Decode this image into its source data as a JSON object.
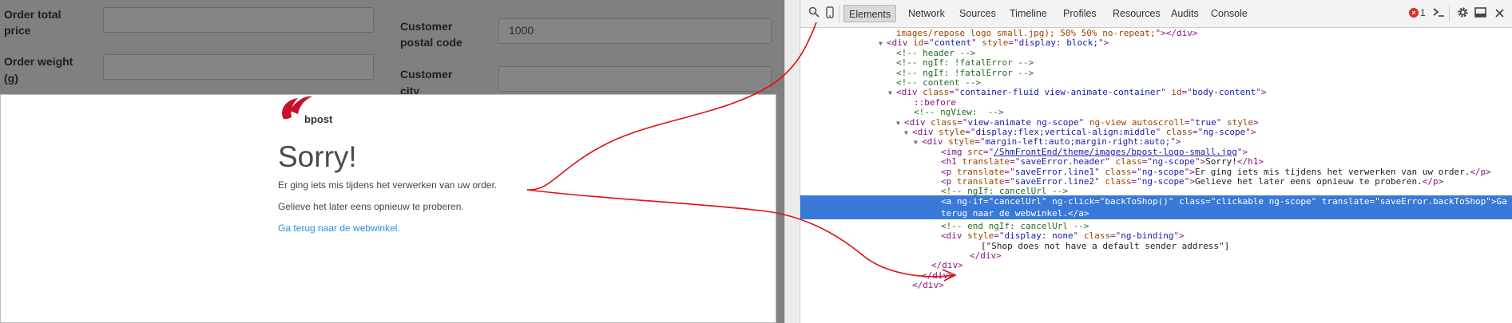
{
  "form": {
    "order_total_label_1": "Order total",
    "order_total_label_2": "price",
    "order_total_value": "",
    "order_weight_label_1": "Order weight",
    "order_weight_label_2": "(g)",
    "order_weight_value": "",
    "customer_postal_label_1": "Customer",
    "customer_postal_label_2": "postal code",
    "customer_postal_value": "1000",
    "customer_city_label_1": "Customer",
    "customer_city_label_2": "city",
    "customer_city_value": ""
  },
  "modal": {
    "logo_text": "bpost",
    "logo_color": "#c8102e",
    "heading": "Sorry!",
    "line1": "Er ging iets mis tijdens het verwerken van uw order.",
    "line2": "Gelieve het later eens opnieuw te proberen.",
    "back_link": "Ga terug naar de webwinkel."
  },
  "devtools": {
    "icons": [
      "search-icon",
      "device-icon"
    ],
    "tabs": [
      {
        "label": "Elements",
        "active": true
      },
      {
        "label": "Network",
        "active": false
      },
      {
        "label": "Sources",
        "active": false
      },
      {
        "label": "Timeline",
        "active": false
      },
      {
        "label": "Profiles",
        "active": false
      },
      {
        "label": "Resources",
        "active": false
      },
      {
        "label": "Audits",
        "active": false
      },
      {
        "label": "Console",
        "active": false
      }
    ],
    "error_count": "1",
    "right_icons": [
      "console-drawer-icon",
      "gear-icon",
      "dock-icon",
      "close-icon"
    ],
    "selection_color": "#3879d9",
    "dom_lines": [
      {
        "indent": 120,
        "parts": [
          [
            "t-attr",
            "images/repose logo small.jpg); 50% 50% no-repeat;"
          ],
          [
            "t-tag",
            "\"></div>"
          ]
        ]
      },
      {
        "indent": 108,
        "tw": "▼",
        "parts": [
          [
            "t-tag",
            "<div "
          ],
          [
            "t-attr",
            "id"
          ],
          [
            "t-tag",
            "=\""
          ],
          [
            "t-val",
            "content"
          ],
          [
            "t-tag",
            "\" "
          ],
          [
            "t-attr",
            "style"
          ],
          [
            "t-tag",
            "=\""
          ],
          [
            "t-val",
            "display: block;"
          ],
          [
            "t-tag",
            "\">"
          ]
        ]
      },
      {
        "indent": 120,
        "parts": [
          [
            "t-comment",
            "<!-- header -->"
          ]
        ]
      },
      {
        "indent": 120,
        "parts": [
          [
            "t-comment",
            "<!-- ngIf: !fatalError -->"
          ]
        ]
      },
      {
        "indent": 120,
        "parts": [
          [
            "t-comment",
            "<!-- ngIf: !fatalError -->"
          ]
        ]
      },
      {
        "indent": 120,
        "parts": [
          [
            "t-comment",
            "<!-- content -->"
          ]
        ]
      },
      {
        "indent": 120,
        "tw": "▼",
        "parts": [
          [
            "t-tag",
            "<div "
          ],
          [
            "t-attr",
            "class"
          ],
          [
            "t-tag",
            "=\""
          ],
          [
            "t-val",
            "container-fluid view-animate-container"
          ],
          [
            "t-tag",
            "\" "
          ],
          [
            "t-attr",
            "id"
          ],
          [
            "t-tag",
            "=\""
          ],
          [
            "t-val",
            "body-content"
          ],
          [
            "t-tag",
            "\">"
          ]
        ]
      },
      {
        "indent": 142,
        "parts": [
          [
            "t-pseudo",
            "::before"
          ]
        ]
      },
      {
        "indent": 142,
        "parts": [
          [
            "t-comment",
            "<!-- ngView:  -->"
          ]
        ]
      },
      {
        "indent": 130,
        "tw": "▼",
        "parts": [
          [
            "t-tag",
            "<div "
          ],
          [
            "t-attr",
            "class"
          ],
          [
            "t-tag",
            "=\""
          ],
          [
            "t-val",
            "view-animate ng-scope"
          ],
          [
            "t-tag",
            "\" "
          ],
          [
            "t-attr",
            "ng-view"
          ],
          [
            "t-tag",
            " "
          ],
          [
            "t-attr",
            "autoscroll"
          ],
          [
            "t-tag",
            "=\""
          ],
          [
            "t-val",
            "true"
          ],
          [
            "t-tag",
            "\" "
          ],
          [
            "t-attr",
            "style"
          ],
          [
            "t-tag",
            ">"
          ]
        ]
      },
      {
        "indent": 140,
        "tw": "▼",
        "parts": [
          [
            "t-tag",
            "<div "
          ],
          [
            "t-attr",
            "style"
          ],
          [
            "t-tag",
            "=\""
          ],
          [
            "t-val",
            "display:flex;vertical-align:middle"
          ],
          [
            "t-tag",
            "\" "
          ],
          [
            "t-attr",
            "class"
          ],
          [
            "t-tag",
            "=\""
          ],
          [
            "t-val",
            "ng-scope"
          ],
          [
            "t-tag",
            "\">"
          ]
        ]
      },
      {
        "indent": 152,
        "tw": "▼",
        "parts": [
          [
            "t-tag",
            "<div "
          ],
          [
            "t-attr",
            "style"
          ],
          [
            "t-tag",
            "=\""
          ],
          [
            "t-val",
            "margin-left:auto;margin-right:auto;"
          ],
          [
            "t-tag",
            "\">"
          ]
        ]
      },
      {
        "indent": 176,
        "parts": [
          [
            "t-tag",
            "<img "
          ],
          [
            "t-attr",
            "src"
          ],
          [
            "t-tag",
            "=\""
          ],
          [
            "t-val t-link",
            "/ShmFrontEnd/theme/images/bpost-logo-small.jpg"
          ],
          [
            "t-tag",
            "\">"
          ]
        ]
      },
      {
        "indent": 176,
        "parts": [
          [
            "t-tag",
            "<h1 "
          ],
          [
            "t-attr",
            "translate"
          ],
          [
            "t-tag",
            "=\""
          ],
          [
            "t-val",
            "saveError.header"
          ],
          [
            "t-tag",
            "\" "
          ],
          [
            "t-attr",
            "class"
          ],
          [
            "t-tag",
            "=\""
          ],
          [
            "t-val",
            "ng-scope"
          ],
          [
            "t-tag",
            "\">"
          ],
          [
            "t-text",
            "Sorry!"
          ],
          [
            "t-tag",
            "</h1>"
          ]
        ]
      },
      {
        "indent": 176,
        "parts": [
          [
            "t-tag",
            "<p "
          ],
          [
            "t-attr",
            "translate"
          ],
          [
            "t-tag",
            "=\""
          ],
          [
            "t-val",
            "saveError.line1"
          ],
          [
            "t-tag",
            "\" "
          ],
          [
            "t-attr",
            "class"
          ],
          [
            "t-tag",
            "=\""
          ],
          [
            "t-val",
            "ng-scope"
          ],
          [
            "t-tag",
            "\">"
          ],
          [
            "t-text",
            "Er ging iets mis tijdens het verwerken van uw order."
          ],
          [
            "t-tag",
            "</p>"
          ]
        ]
      },
      {
        "indent": 176,
        "parts": [
          [
            "t-tag",
            "<p "
          ],
          [
            "t-attr",
            "translate"
          ],
          [
            "t-tag",
            "=\""
          ],
          [
            "t-val",
            "saveError.line2"
          ],
          [
            "t-tag",
            "\" "
          ],
          [
            "t-attr",
            "class"
          ],
          [
            "t-tag",
            "=\""
          ],
          [
            "t-val",
            "ng-scope"
          ],
          [
            "t-tag",
            "\">"
          ],
          [
            "t-text",
            "Gelieve het later eens opnieuw te proberen."
          ],
          [
            "t-tag",
            "</p>"
          ]
        ]
      },
      {
        "indent": 176,
        "parts": [
          [
            "t-comment",
            "<!-- ngIf: cancelUrl -->"
          ]
        ]
      },
      {
        "indent": 176,
        "selected": true,
        "parts": [
          [
            "t-tag",
            "<a "
          ],
          [
            "t-attr",
            "ng-if"
          ],
          [
            "t-tag",
            "=\""
          ],
          [
            "t-val",
            "cancelUrl"
          ],
          [
            "t-tag",
            "\" "
          ],
          [
            "t-attr",
            "ng-click"
          ],
          [
            "t-tag",
            "=\""
          ],
          [
            "t-val",
            "backToShop()"
          ],
          [
            "t-tag",
            "\" "
          ],
          [
            "t-attr",
            "class"
          ],
          [
            "t-tag",
            "=\""
          ],
          [
            "t-val",
            "clickable ng-scope"
          ],
          [
            "t-tag",
            "\" "
          ],
          [
            "t-attr",
            "translate"
          ],
          [
            "t-tag",
            "=\""
          ],
          [
            "t-val",
            "saveError.backToShop"
          ],
          [
            "t-tag",
            "\">"
          ],
          [
            "t-text",
            "Ga"
          ]
        ],
        "cont": [
          [
            "t-text",
            "terug naar de webwinkel."
          ],
          [
            "t-tag",
            "</a>"
          ]
        ]
      },
      {
        "indent": 176,
        "parts": [
          [
            "t-comment",
            "<!-- end ngIf: cancelUrl -->"
          ]
        ]
      },
      {
        "indent": 176,
        "parts": [
          [
            "t-tag",
            "<div "
          ],
          [
            "t-attr",
            "style"
          ],
          [
            "t-tag",
            "=\""
          ],
          [
            "t-val",
            "display: none"
          ],
          [
            "t-tag",
            "\" "
          ],
          [
            "t-attr",
            "class"
          ],
          [
            "t-tag",
            "=\""
          ],
          [
            "t-val",
            "ng-binding"
          ],
          [
            "t-tag",
            "\">"
          ]
        ]
      },
      {
        "indent": 226,
        "parts": [
          [
            "t-text",
            "[\"Shop does not have a default sender address\"]"
          ]
        ]
      },
      {
        "indent": 212,
        "parts": [
          [
            "t-tag",
            "</div>"
          ]
        ]
      },
      {
        "indent": 164,
        "parts": [
          [
            "t-tag",
            "</div>"
          ]
        ]
      },
      {
        "indent": 152,
        "parts": [
          [
            "t-tag",
            "</div>"
          ]
        ]
      },
      {
        "indent": 140,
        "parts": [
          [
            "t-tag",
            "</div>"
          ]
        ]
      }
    ]
  },
  "annotation_color": "#e01010"
}
